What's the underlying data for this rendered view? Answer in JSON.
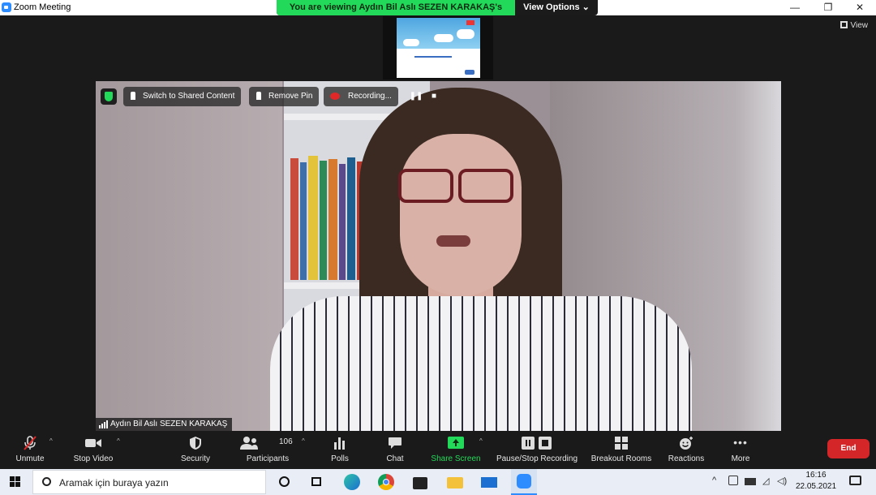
{
  "window": {
    "title": "Zoom Meeting",
    "minimize": "—",
    "restore": "❐",
    "close": "✕"
  },
  "share_banner": {
    "message": "You are viewing Aydın Bil Aslı SEZEN KARAKAŞ's screen",
    "options": "View Options ⌄"
  },
  "view_button": "View",
  "video_overlay": {
    "switch_label": "Switch to Shared Content",
    "remove_pin_label": "Remove Pin",
    "recording_label": "Recording...",
    "pause_glyph": "❚❚",
    "stop_glyph": "■",
    "participant_name": "Aydın Bil Aslı SEZEN KARAKAŞ"
  },
  "toolbar": {
    "unmute": "Unmute",
    "stop_video": "Stop Video",
    "security": "Security",
    "participants": "Participants",
    "participant_count": "106",
    "polls": "Polls",
    "chat": "Chat",
    "share_screen": "Share Screen",
    "pause_stop_recording": "Pause/Stop Recording",
    "breakout_rooms": "Breakout Rooms",
    "reactions": "Reactions",
    "more": "More",
    "more_glyph": "•••",
    "end": "End"
  },
  "taskbar": {
    "search_placeholder": "Aramak için buraya yazın",
    "time": "16:16",
    "date": "22.05.2021"
  },
  "colors": {
    "zoom_blue": "#2d8cff",
    "banner_green": "#23d959",
    "end_red": "#d42628"
  }
}
